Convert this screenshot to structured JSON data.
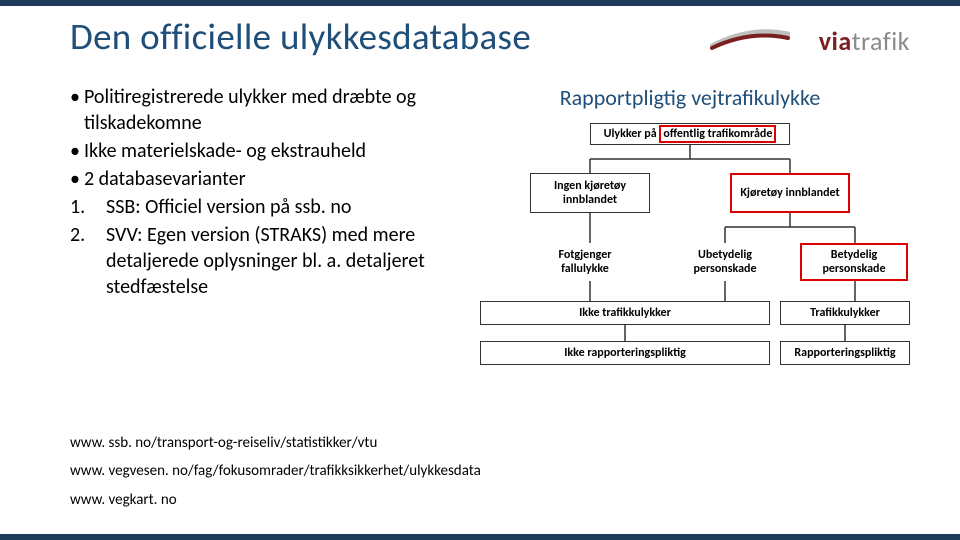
{
  "header": {
    "title": "Den officielle ulykkesdatabase",
    "logo_via": "via",
    "logo_trafik": "trafik"
  },
  "bullets": {
    "b1": "Politiregistrerede ulykker med dræbte og tilskadekomne",
    "b2": "Ikke materielskade- og  ekstrauheld",
    "b3": "2 databasevarianter",
    "n1": "SSB: Officiel version på ssb. no",
    "n2": "SVV: Egen version (STRAKS) med mere detaljerede oplysninger bl. a. detaljeret stedfæstelse"
  },
  "right_title": "Rapportpligtig vejtrafikulykke",
  "diagram": {
    "top": "Ulykker på offentlig trafikområde",
    "left1": "Ingen kjøretøy innblandet",
    "right1": "Kjøretøy innblandet",
    "leaf_l": "Fotgjenger fallulykke",
    "leaf_m": "Ubetydelig personskade",
    "leaf_r": "Betydelig personskade",
    "row1_l": "Ikke trafikkulykker",
    "row1_r": "Trafikkulykker",
    "row2_l": "Ikke rapporteringspliktig",
    "row2_r": "Rapporteringspliktig"
  },
  "links": {
    "l1": "www. ssb. no/transport-og-reiseliv/statistikker/vtu",
    "l2": "www. vegvesen. no/fag/fokusomrader/trafikksikkerhet/ulykkesdata",
    "l3": "www. vegkart. no"
  }
}
